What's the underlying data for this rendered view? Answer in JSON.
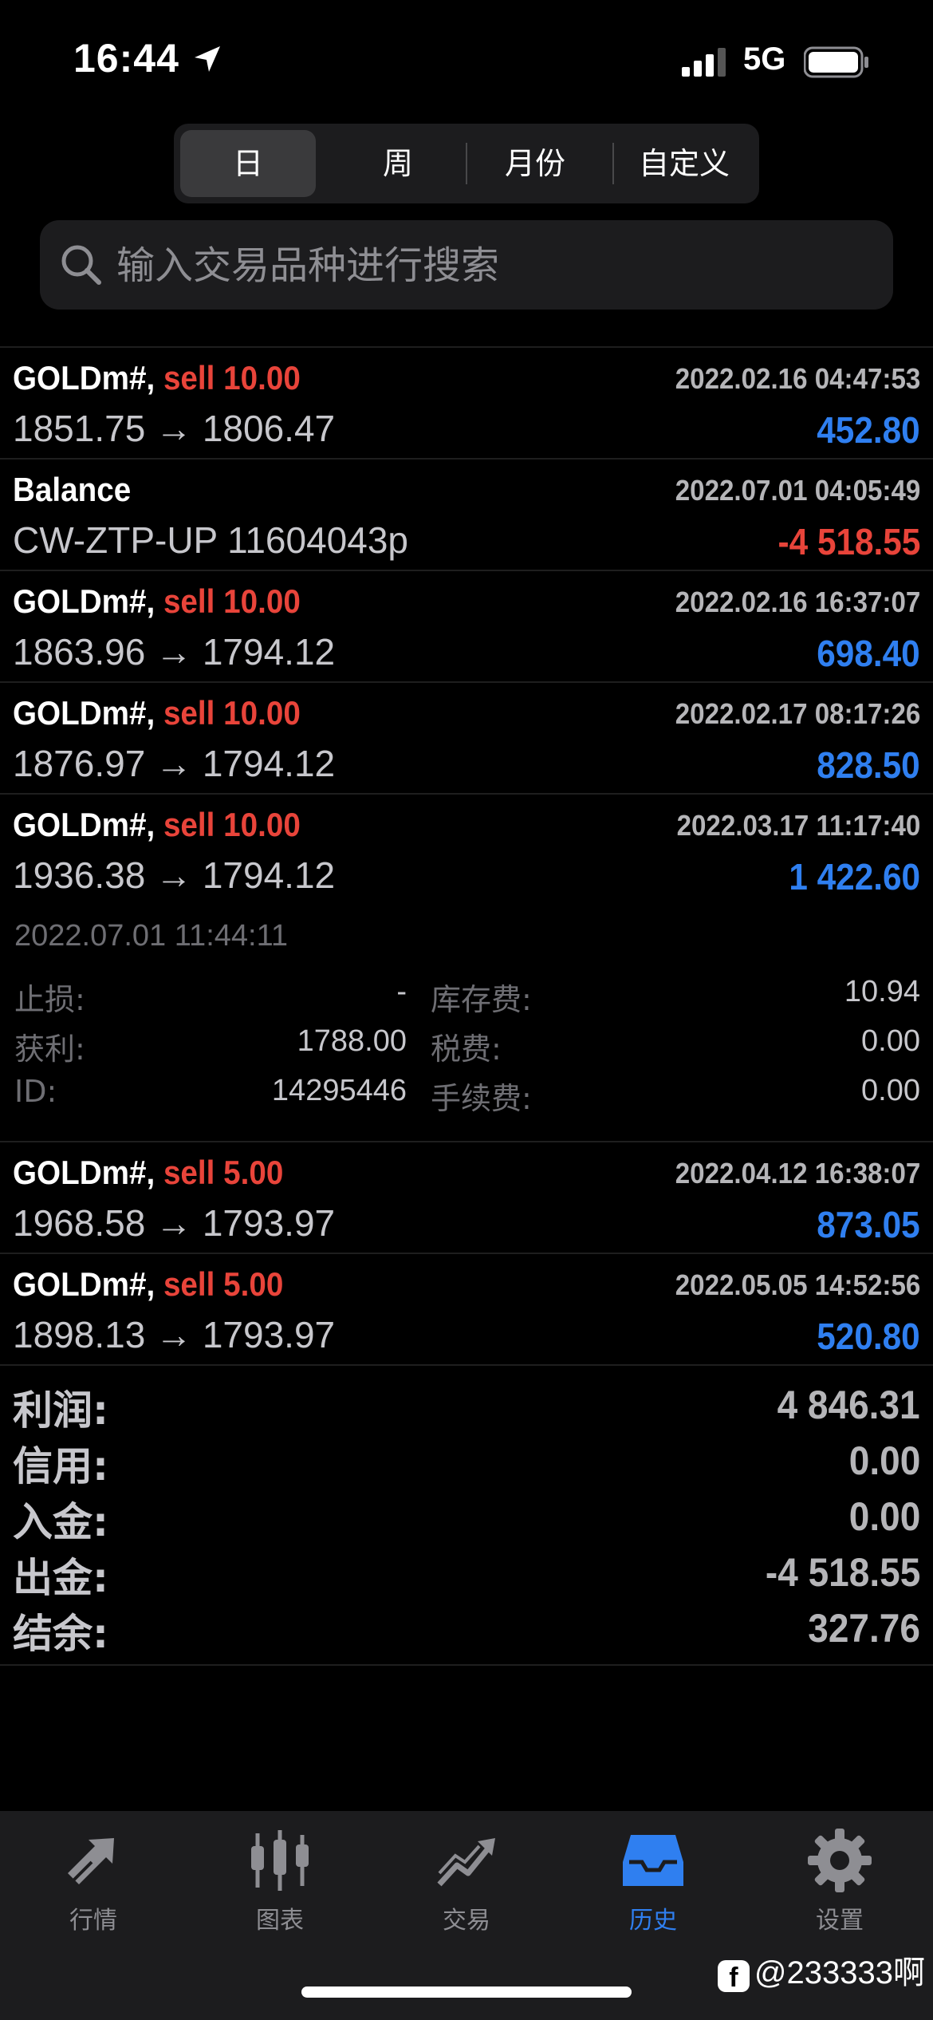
{
  "status": {
    "time": "16:44",
    "network": "5G"
  },
  "periods": {
    "day": "日",
    "week": "周",
    "month": "月份",
    "custom": "自定义"
  },
  "search": {
    "placeholder": "输入交易品种进行搜索"
  },
  "trades": [
    {
      "symbol": "GOLDm#,",
      "side": "sell 10.00",
      "datetime": "2022.02.16 04:47:53",
      "prices": "1851.75 → 1806.47",
      "profit": "452.80"
    },
    {
      "symbol": "Balance",
      "side": "",
      "datetime": "2022.07.01 04:05:49",
      "prices": "CW-ZTP-UP 11604043p",
      "profit": "-4 518.55"
    },
    {
      "symbol": "GOLDm#,",
      "side": "sell 10.00",
      "datetime": "2022.02.16 16:37:07",
      "prices": "1863.96 → 1794.12",
      "profit": "698.40"
    },
    {
      "symbol": "GOLDm#,",
      "side": "sell 10.00",
      "datetime": "2022.02.17 08:17:26",
      "prices": "1876.97 → 1794.12",
      "profit": "828.50"
    },
    {
      "symbol": "GOLDm#,",
      "side": "sell 10.00",
      "datetime": "2022.03.17 11:17:40",
      "prices": "1936.38 → 1794.12",
      "profit": "1 422.60"
    },
    {
      "symbol": "GOLDm#,",
      "side": "sell 5.00",
      "datetime": "2022.04.12 16:38:07",
      "prices": "1968.58 → 1793.97",
      "profit": "873.05"
    },
    {
      "symbol": "GOLDm#,",
      "side": "sell 5.00",
      "datetime": "2022.05.05 14:52:56",
      "prices": "1898.13 → 1793.97",
      "profit": "520.80"
    }
  ],
  "details": {
    "close_time": "2022.07.01 11:44:11",
    "stop_loss_label": "止损:",
    "stop_loss": "-",
    "take_profit_label": "获利:",
    "take_profit": "1788.00",
    "id_label": "ID:",
    "id": "14295446",
    "swap_label": "库存费:",
    "swap": "10.94",
    "taxes_label": "税费:",
    "taxes": "0.00",
    "commission_label": "手续费:",
    "commission": "0.00"
  },
  "summary": {
    "profit_label": "利润:",
    "profit": "4 846.31",
    "credit_label": "信用:",
    "credit": "0.00",
    "deposit_label": "入金:",
    "deposit": "0.00",
    "withdrawal_label": "出金:",
    "withdrawal": "-4 518.55",
    "balance_label": "结余:",
    "balance": "327.76"
  },
  "tabs": {
    "quotes": "行情",
    "charts": "图表",
    "trade": "交易",
    "history": "历史",
    "settings": "设置"
  },
  "watermark": "@233333啊",
  "colors": {
    "profit_positive": "#2f7ff0",
    "loss_negative": "#e8443a",
    "sell": "#e8443a",
    "active_tab": "#2f7ff0"
  }
}
